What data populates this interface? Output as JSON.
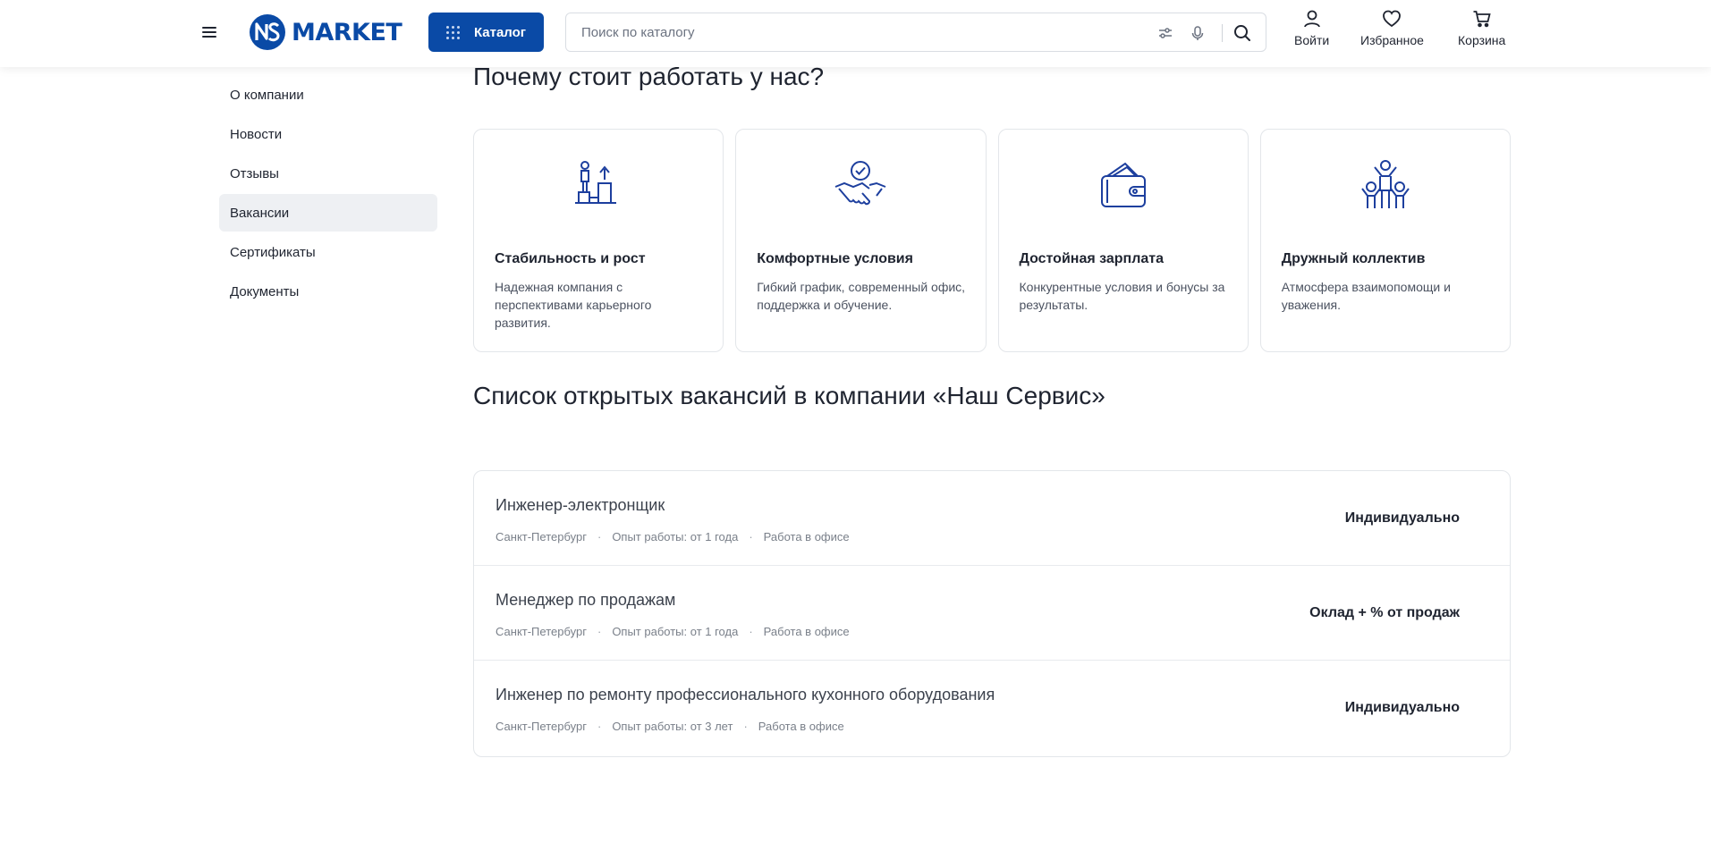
{
  "header": {
    "logo_text": "MARKET",
    "catalog_label": "Каталог",
    "search_placeholder": "Поиск по каталогу",
    "actions": [
      {
        "label": "Войти",
        "icon": "user-icon"
      },
      {
        "label": "Избранное",
        "icon": "heart-icon"
      },
      {
        "label": "Корзина",
        "icon": "cart-icon"
      }
    ],
    "accent_color": "#0a4aa6"
  },
  "sidebar": {
    "items": [
      {
        "label": "О компании"
      },
      {
        "label": "Новости"
      },
      {
        "label": "Отзывы"
      },
      {
        "label": "Вакансии",
        "active": true
      },
      {
        "label": "Сертификаты"
      },
      {
        "label": "Документы"
      }
    ]
  },
  "why": {
    "title": "Почему стоит работать у нас?",
    "cards": [
      {
        "icon": "career-growth-icon",
        "title": "Стабильность и рост",
        "desc": "Надежная компания с перспективами карьерного развития."
      },
      {
        "icon": "handshake-icon",
        "title": "Комфортные условия",
        "desc": "Гибкий график, современный офис, поддержка и обучение."
      },
      {
        "icon": "wallet-icon",
        "title": "Достойная зарплата",
        "desc": "Конкурентные условия и бонусы за результаты."
      },
      {
        "icon": "team-icon",
        "title": "Дружный коллектив",
        "desc": "Атмосфера взаимопомощи и уважения."
      }
    ]
  },
  "vacancies": {
    "title": "Список открытых вакансий в компании «Наш Сервис»",
    "items": [
      {
        "title": "Инженер-электронщик",
        "city": "Санкт-Петербург",
        "experience": "Опыт работы: от 1 года",
        "format": "Работа в офисе",
        "salary": "Индивидуально"
      },
      {
        "title": "Менеджер по продажам",
        "city": "Санкт-Петербург",
        "experience": "Опыт работы: от 1 года",
        "format": "Работа в офисе",
        "salary": "Оклад + % от продаж"
      },
      {
        "title": "Инженер по ремонту профессионального кухонного оборудования",
        "city": "Санкт-Петербург",
        "experience": "Опыт работы: от 3 лет",
        "format": "Работа в офисе",
        "salary": "Индивидуально"
      }
    ]
  }
}
